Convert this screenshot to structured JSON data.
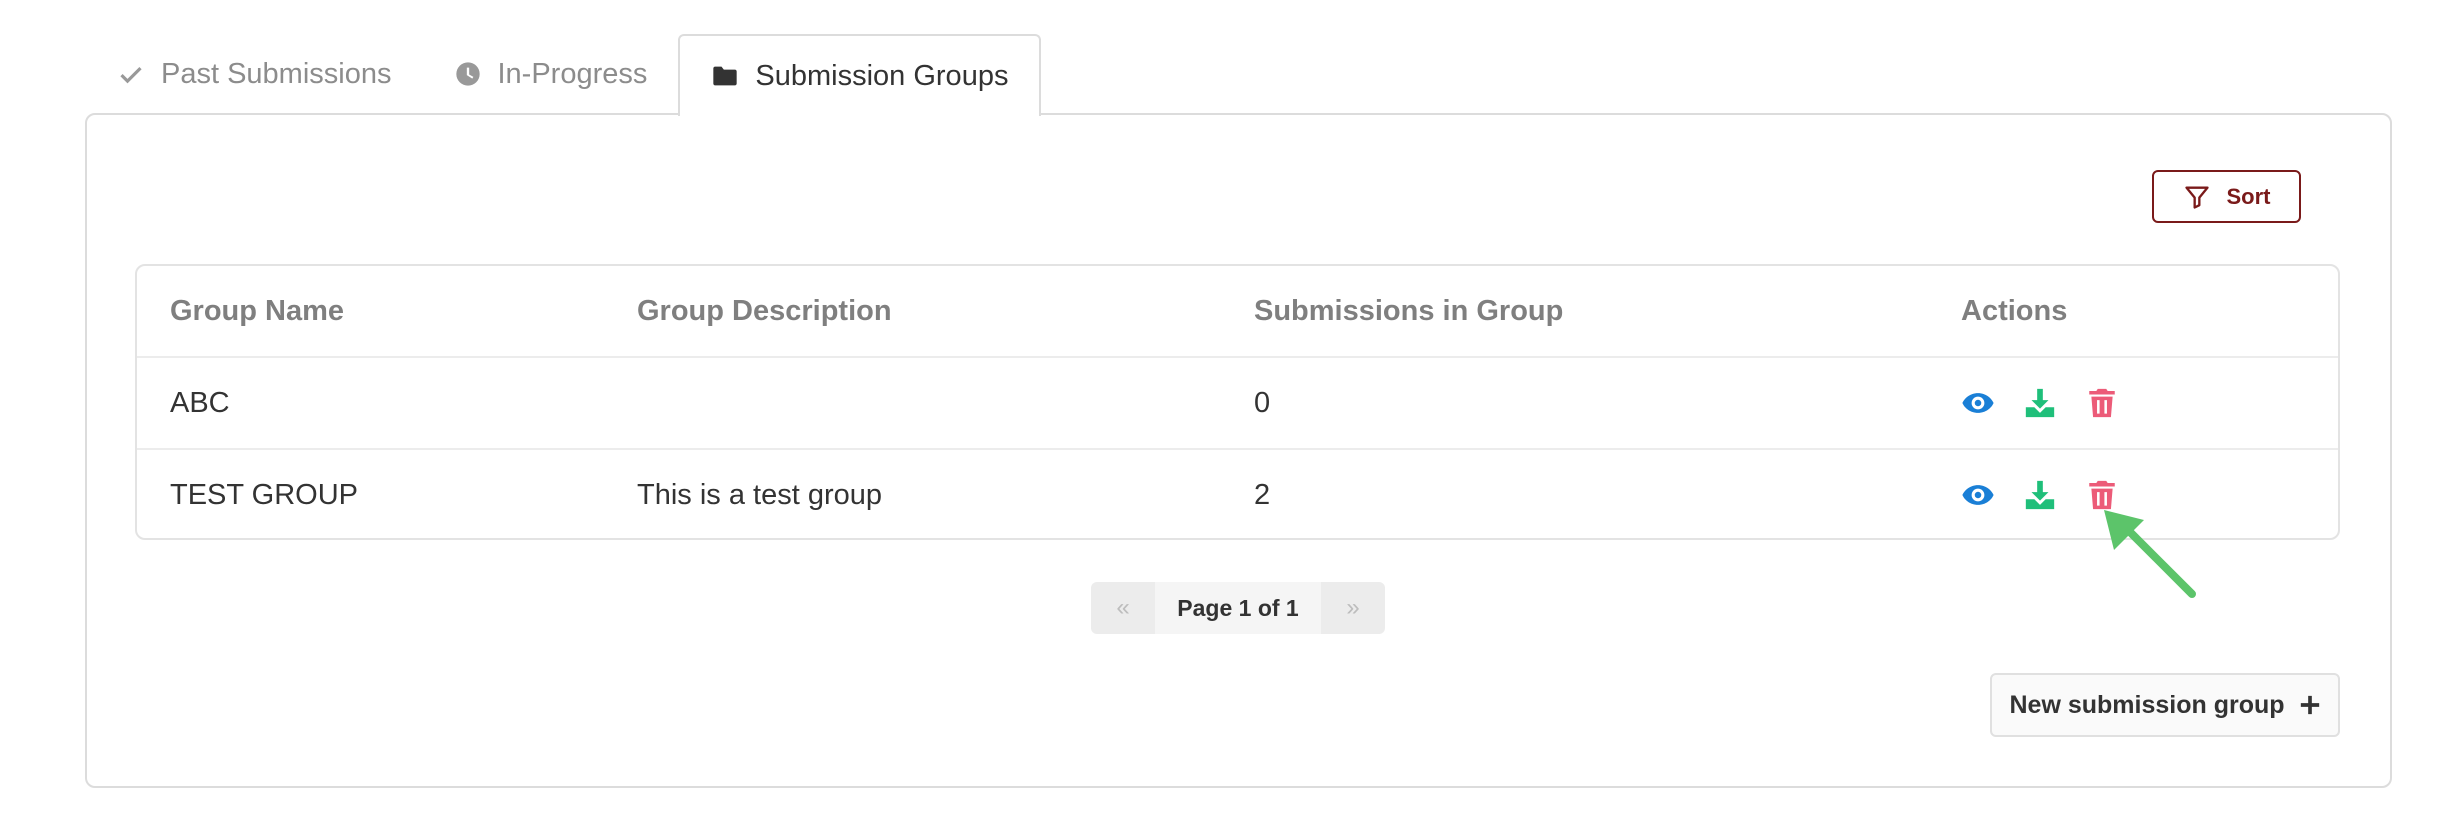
{
  "tabs": [
    {
      "label": "Past Submissions",
      "icon": "check-icon",
      "active": false
    },
    {
      "label": "In-Progress",
      "icon": "clock-icon",
      "active": false
    },
    {
      "label": "Submission Groups",
      "icon": "folder-icon",
      "active": true
    }
  ],
  "toolbar": {
    "sort_label": "Sort",
    "sort_icon": "filter-icon"
  },
  "table": {
    "headers": [
      "Group Name",
      "Group Description",
      "Submissions in Group",
      "Actions"
    ],
    "rows": [
      {
        "name": "ABC",
        "description": "",
        "count": "0"
      },
      {
        "name": "TEST GROUP",
        "description": "This is a test group",
        "count": "2"
      }
    ],
    "action_icons": [
      "eye-icon",
      "download-icon",
      "trash-icon"
    ]
  },
  "pagination": {
    "prev": "«",
    "label": "Page 1 of 1",
    "next": "»"
  },
  "new_group": {
    "label": "New submission group",
    "icon": "plus-icon"
  },
  "colors": {
    "view": "#1a7fd6",
    "download": "#1fbf7a",
    "delete": "#ec5b78",
    "sort_accent": "#7a1a1a",
    "annotation_arrow": "#5cc46a"
  }
}
